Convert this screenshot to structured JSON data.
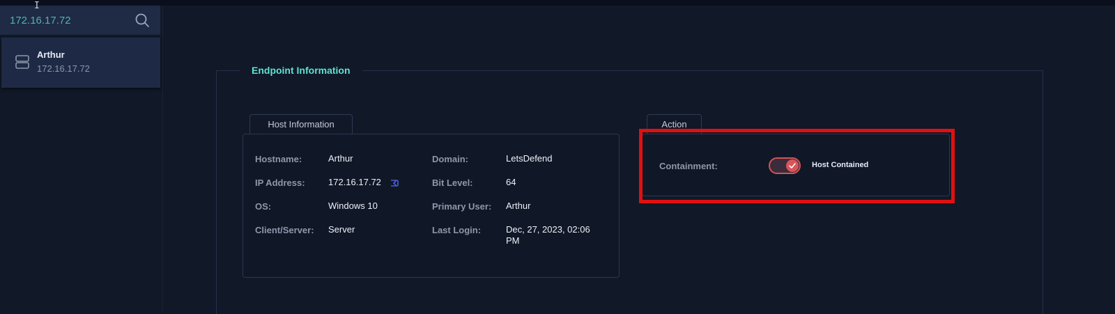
{
  "search": {
    "value": "172.16.17.72",
    "icon": "search-icon"
  },
  "result": {
    "icon": "server-icon",
    "name": "Arthur",
    "ip": "172.16.17.72"
  },
  "endpoint": {
    "title": "Endpoint Information"
  },
  "host_info": {
    "tab_label": "Host Information",
    "fields": {
      "hostname": {
        "label": "Hostname:",
        "value": "Arthur"
      },
      "ip_address": {
        "label": "IP Address:",
        "value": "172.16.17.72"
      },
      "os": {
        "label": "OS:",
        "value": "Windows 10"
      },
      "client_server": {
        "label": "Client/Server:",
        "value": "Server"
      },
      "domain": {
        "label": "Domain:",
        "value": "LetsDefend"
      },
      "bit_level": {
        "label": "Bit Level:",
        "value": "64"
      },
      "primary_user": {
        "label": "Primary User:",
        "value": "Arthur"
      },
      "last_login": {
        "label": "Last Login:",
        "value": "Dec, 27, 2023, 02:06 PM"
      }
    }
  },
  "action": {
    "tab_label": "Action",
    "containment_label": "Containment:",
    "toggle_on": true,
    "toggle_text": "Host Contained"
  },
  "colors": {
    "accent": "#5ee3d4",
    "toggle": "#d9555a",
    "highlight": "#e01010",
    "background": "#111827"
  }
}
